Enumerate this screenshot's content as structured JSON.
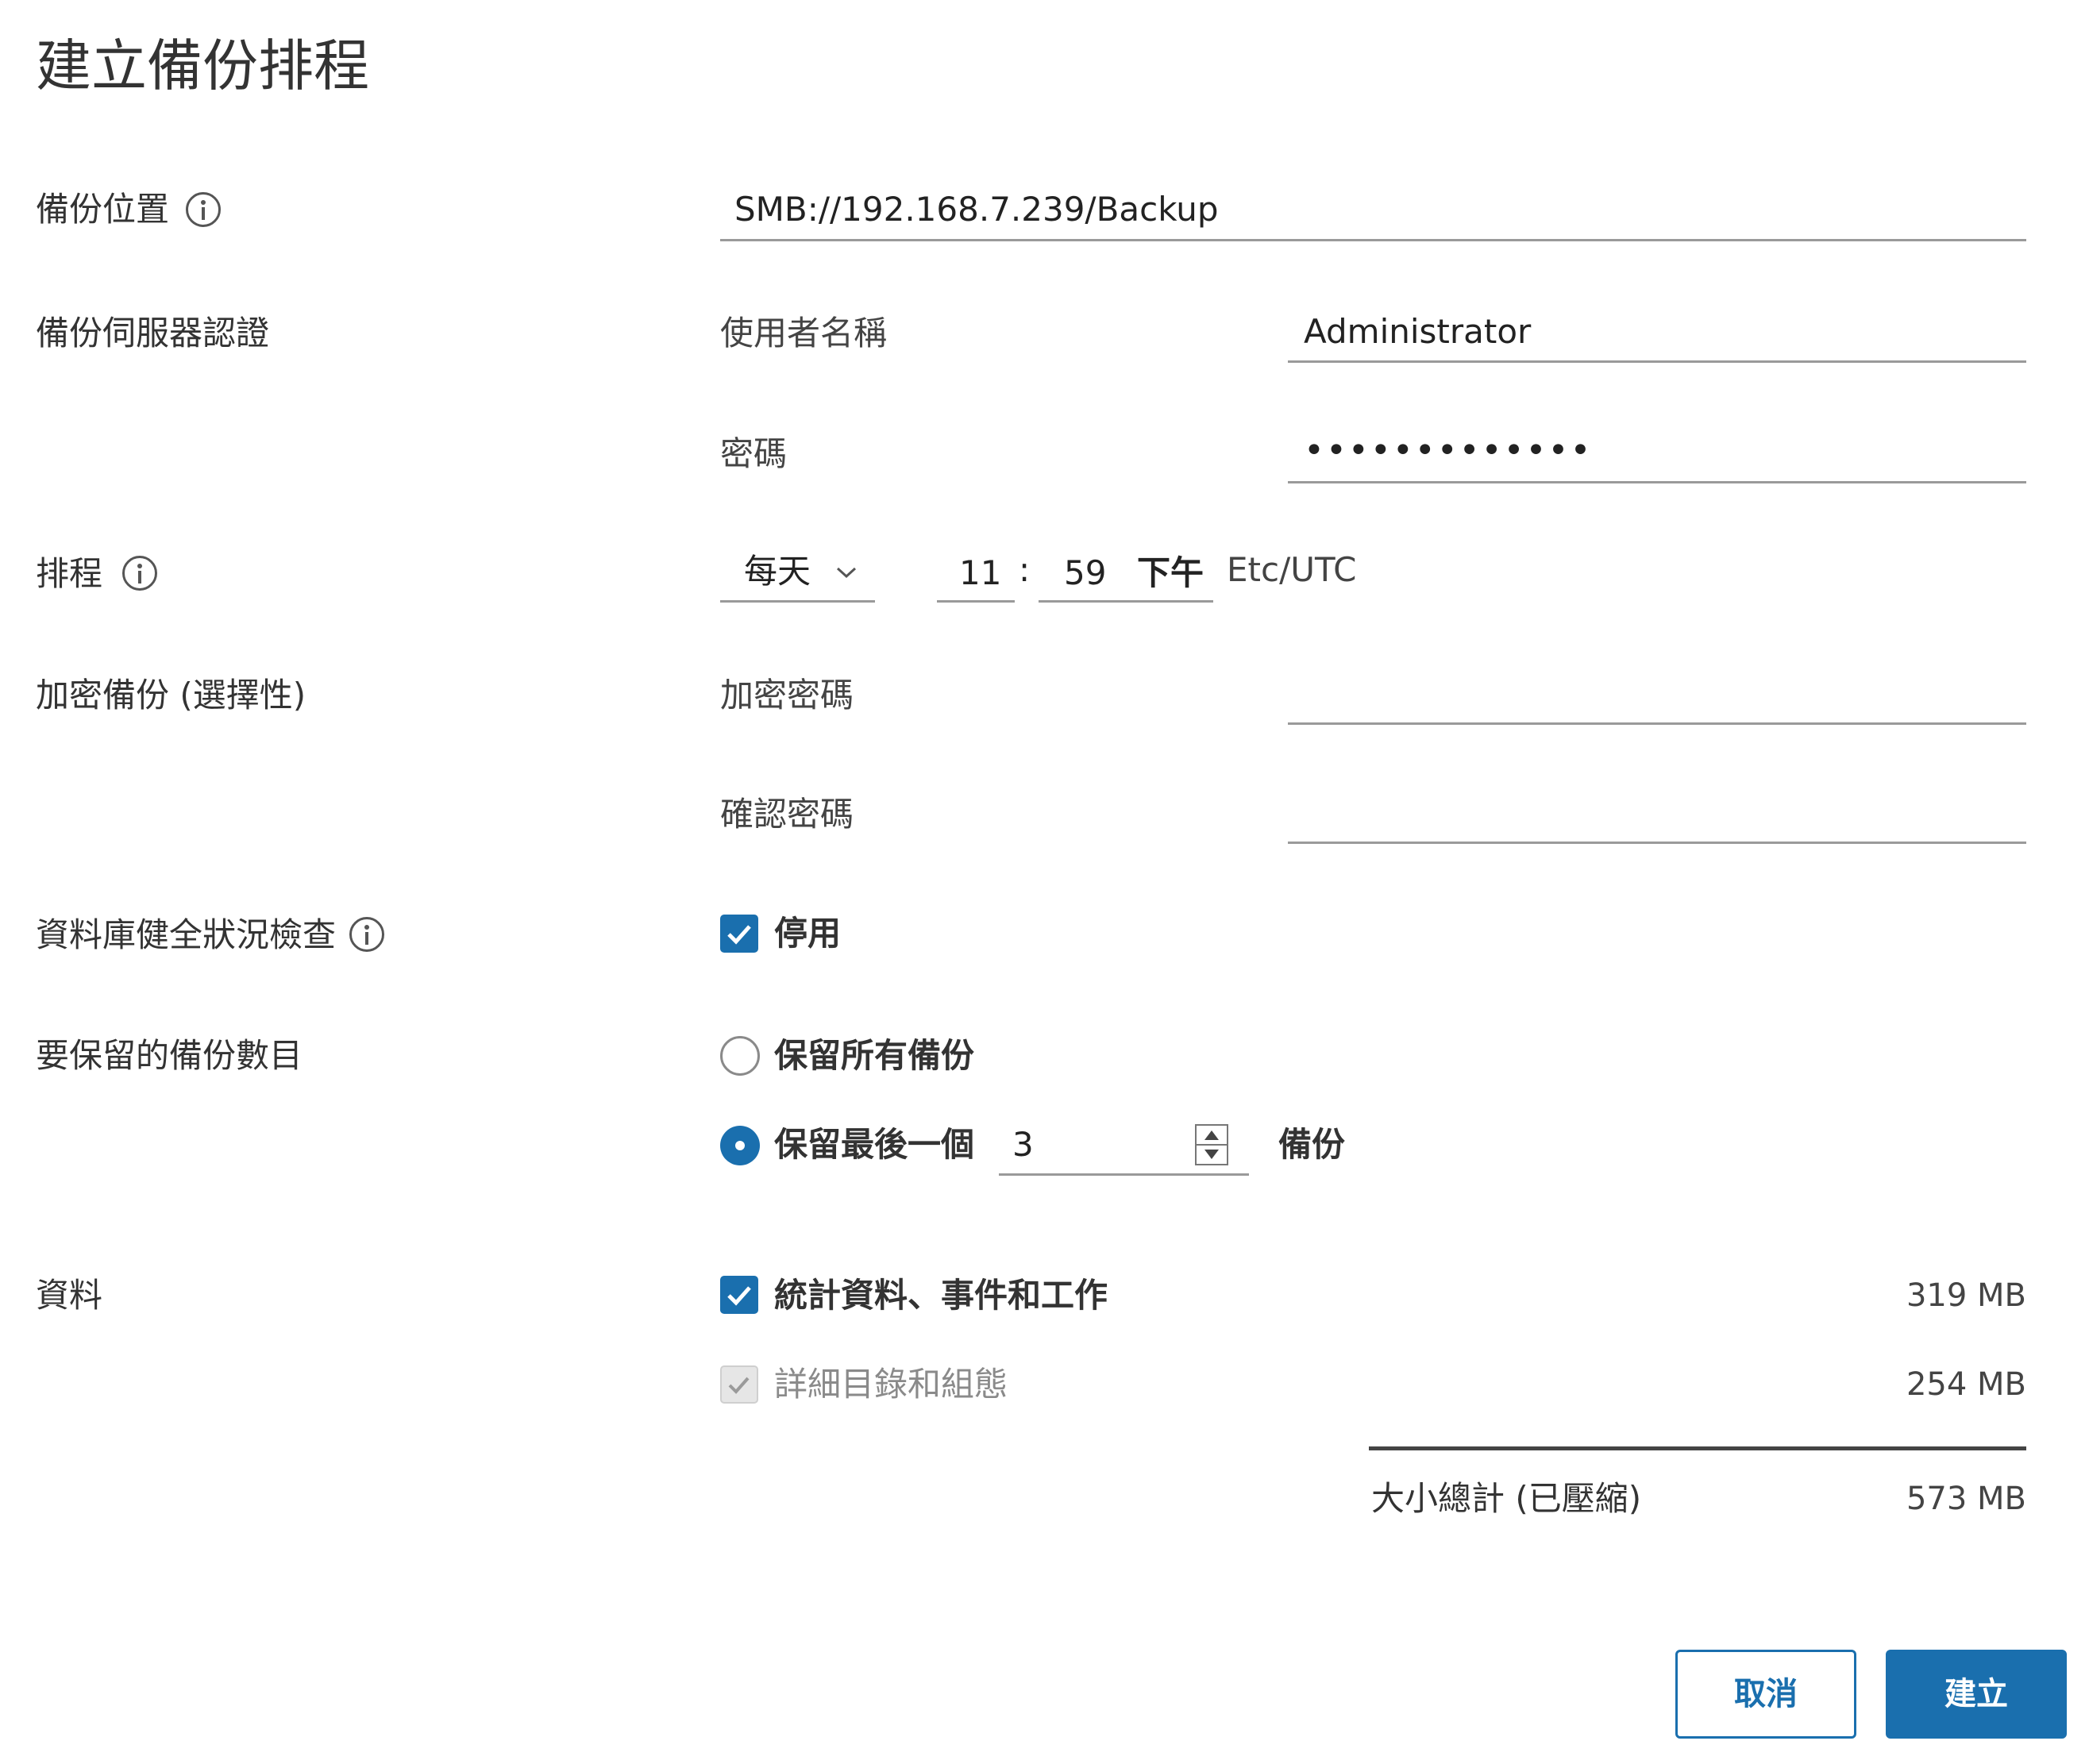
{
  "dialog": {
    "title": "建立備份排程"
  },
  "location": {
    "label": "備份位置",
    "value": "SMB://192.168.7.239/Backup"
  },
  "credentials": {
    "label": "備份伺服器認證",
    "username_label": "使用者名稱",
    "username_value": "Administrator",
    "password_label": "密碼",
    "password_value": "•••••••••••••"
  },
  "schedule": {
    "label": "排程",
    "frequency": "每天",
    "hour": "11",
    "separator": ":",
    "minute": "59",
    "ampm": "下午",
    "timezone": "Etc/UTC"
  },
  "encryption": {
    "label": "加密備份 (選擇性)",
    "password_label": "加密密碼",
    "confirm_label": "確認密碼"
  },
  "db_health": {
    "label": "資料庫健全狀況檢查",
    "checkbox_label": "停用",
    "checked": true
  },
  "retention": {
    "label": "要保留的備份數目",
    "keep_all_label": "保留所有備份",
    "keep_last_label": "保留最後一個",
    "keep_last_value": "3",
    "unit": "備份",
    "selected": "keep_last"
  },
  "data": {
    "label": "資料",
    "items": [
      {
        "label": "統計資料、事件和工作",
        "size": "319 MB",
        "checked": true,
        "disabled": false
      },
      {
        "label": "詳細目錄和組態",
        "size": "254 MB",
        "checked": true,
        "disabled": true
      }
    ],
    "total_label": "大小總計 (已壓縮)",
    "total_size": "573 MB"
  },
  "buttons": {
    "cancel": "取消",
    "create": "建立"
  },
  "colors": {
    "primary": "#1a6fae",
    "underline": "#9a9a9a",
    "text": "#333333"
  },
  "icons": [
    "info-icon",
    "chevron-down-icon",
    "check-icon",
    "spinner-icon"
  ]
}
